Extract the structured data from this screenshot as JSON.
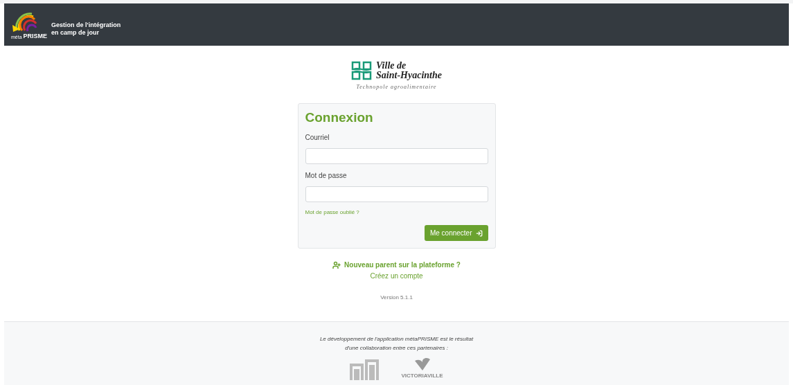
{
  "header": {
    "logo": {
      "small": "méta",
      "big": "PRISME"
    },
    "title_line_1": "Gestion de l'intégration",
    "title_line_2": "en camp de jour"
  },
  "city_logo": {
    "line_1": "Ville de",
    "line_2": "Saint-Hyacinthe",
    "tagline": "Technopole agroalimentaire"
  },
  "login": {
    "title": "Connexion",
    "fields": [
      {
        "label": "Courriel"
      },
      {
        "label": "Mot de passe"
      }
    ],
    "forgot_link": "Mot de passe oublié ?",
    "submit": "Me connecter"
  },
  "signup": {
    "question": "Nouveau parent sur la plateforme ?",
    "link": "Créez un compte"
  },
  "version": "Version 5.1.1",
  "footer": {
    "text_line_1": "Le développement de l'application métaPRISME est le résultat",
    "text_line_2": "d'une collaboration entre ces partenaires :",
    "partners": [
      {
        "kind": "mark"
      },
      {
        "kind": "city",
        "name": "VICTORIAVILLE"
      }
    ]
  }
}
